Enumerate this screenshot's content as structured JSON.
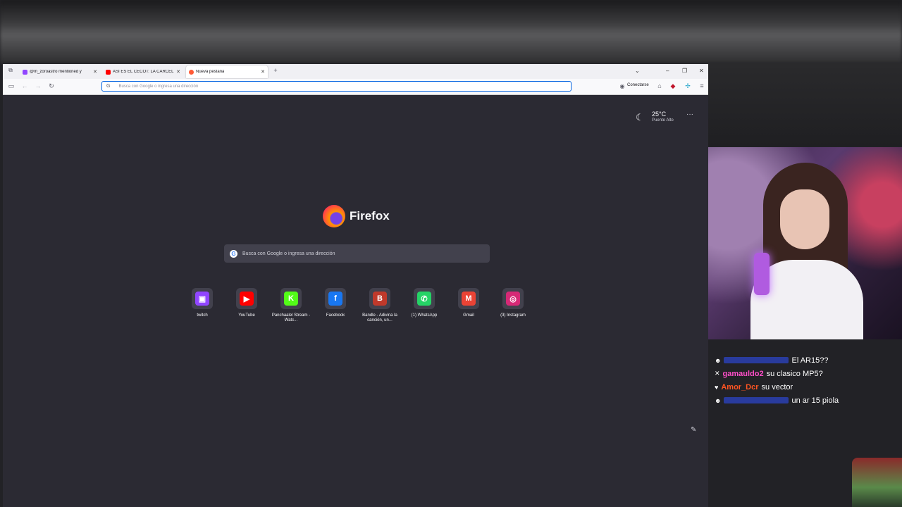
{
  "tabs": [
    {
      "title": "@m_zoroastro mentioned y",
      "favicon_color": "#9146ff"
    },
    {
      "title": "ASÍ ES EL CECOT: LA CÁRCEL M",
      "favicon_color": "#ff0000"
    },
    {
      "title": "Nueva pestaña",
      "favicon_color": "#ff5a36",
      "active": true
    }
  ],
  "urlbar": {
    "placeholder": "Busca con Google o ingresa una dirección",
    "engine_icon": "G"
  },
  "toolbar": {
    "connect_label": "Conectarse"
  },
  "weather": {
    "temperature": "25°C",
    "location": "Puente Alto"
  },
  "brand": {
    "name": "Firefox"
  },
  "search": {
    "placeholder": "Busca con Google o ingresa una dirección"
  },
  "shortcuts": [
    {
      "label": "twitch",
      "icon": "twitch-icon",
      "glyph": "▣",
      "color": "#9146ff"
    },
    {
      "label": "YouTube",
      "icon": "youtube-icon",
      "glyph": "▶",
      "color": "#ff0000"
    },
    {
      "label": "Panchaalel Stream - Watc...",
      "icon": "kick-icon",
      "glyph": "K",
      "color": "#53fc18"
    },
    {
      "label": "Facebook",
      "icon": "facebook-icon",
      "glyph": "f",
      "color": "#1877f2"
    },
    {
      "label": "Bandle - Adivina la canción, un...",
      "icon": "bandle-icon",
      "glyph": "B",
      "color": "#c0392b"
    },
    {
      "label": "(1) WhatsApp",
      "icon": "whatsapp-icon",
      "glyph": "✆",
      "color": "#25d366"
    },
    {
      "label": "Gmail",
      "icon": "gmail-icon",
      "glyph": "M",
      "color": "#ea4335"
    },
    {
      "label": "(3) Instagram",
      "icon": "instagram-icon",
      "glyph": "◎",
      "color": "#d62976"
    }
  ],
  "chat": [
    {
      "badge": "☻",
      "user": "",
      "user_color": "#3050ff",
      "text": "El AR15??"
    },
    {
      "badge": "✕",
      "user": "gamauldo2",
      "user_color": "#ff4fc8",
      "text": "su clasico MP5?"
    },
    {
      "badge": "♥",
      "user": "Amor_Dcr",
      "user_color": "#ff5522",
      "text": "su vector"
    },
    {
      "badge": "☻",
      "user": "",
      "user_color": "#3050ff",
      "text": "un ar 15 piola"
    }
  ]
}
